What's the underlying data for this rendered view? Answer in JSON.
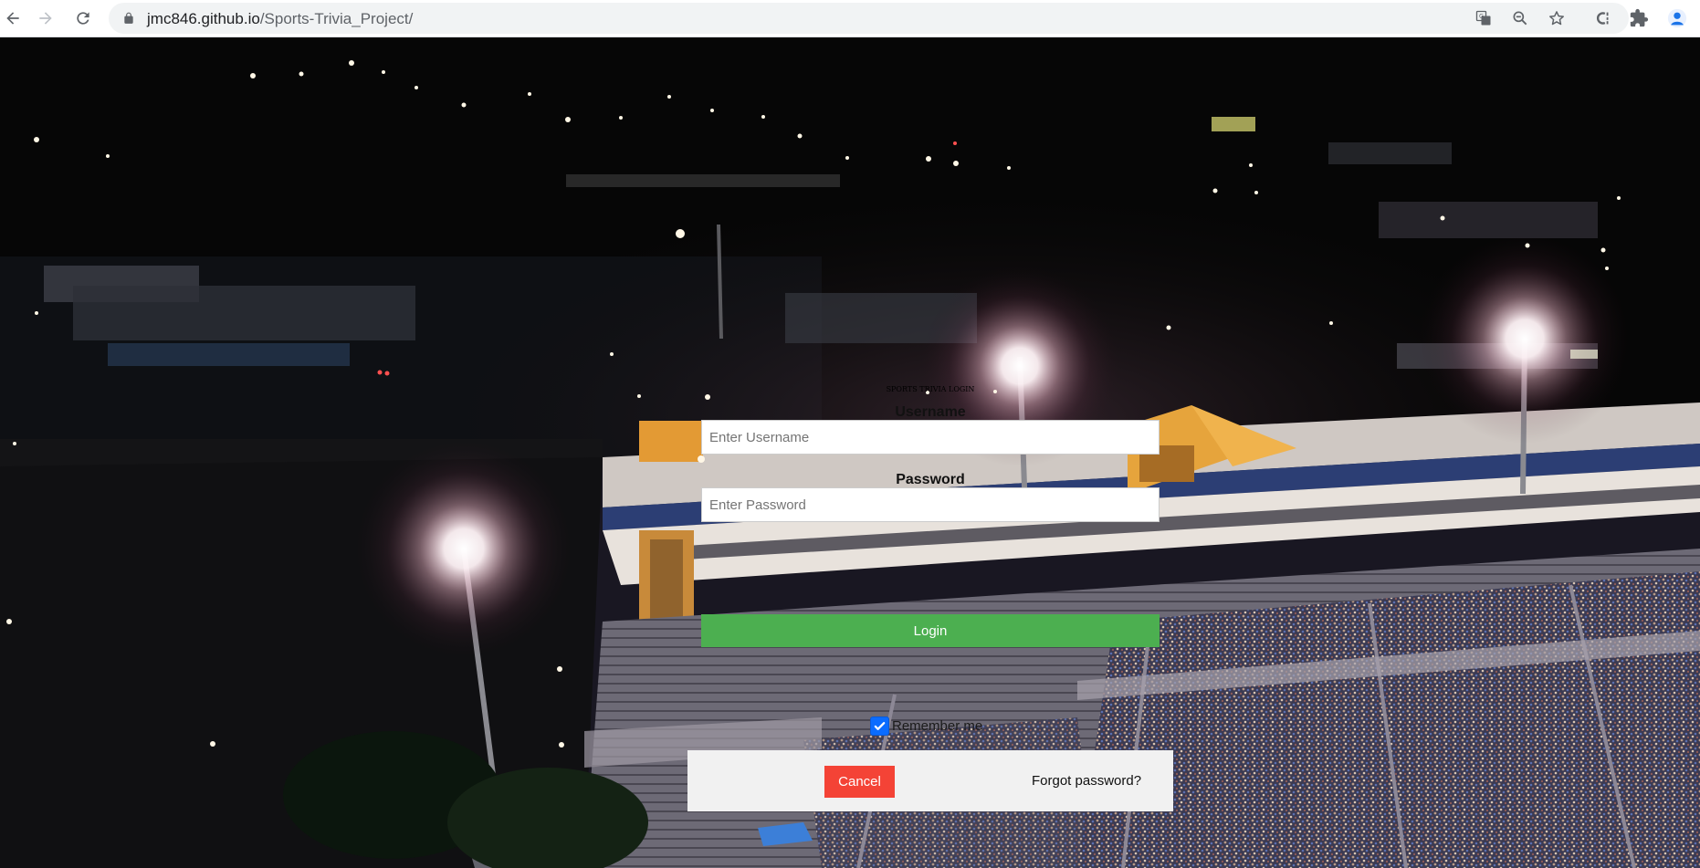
{
  "browser": {
    "url_host": "jmc846.github.io",
    "url_path": "/Sports-Trivia_Project/"
  },
  "login": {
    "heading": "SPORTS TRIVIA LOGIN",
    "username_label": "Username",
    "username_placeholder": "Enter Username",
    "password_label": "Password",
    "password_placeholder": "Enter Password",
    "login_button": "Login",
    "remember_me_label": "Remember me",
    "remember_me_checked": true,
    "cancel_button": "Cancel",
    "forgot_password_text": "Forgot password?"
  },
  "colors": {
    "login_button": "#4caf50",
    "cancel_button": "#f44336",
    "footer_bar": "#f1f1f1",
    "checkbox": "#0a6cff"
  },
  "icons": {
    "back": "arrow-left-icon",
    "forward": "arrow-right-icon",
    "reload": "reload-icon",
    "lock": "lock-icon",
    "translate": "translate-icon",
    "zoom": "zoom-out-icon",
    "bookmark": "star-icon",
    "extension_c": "extension-c-icon",
    "extensions": "puzzle-icon",
    "profile": "profile-avatar-icon"
  }
}
